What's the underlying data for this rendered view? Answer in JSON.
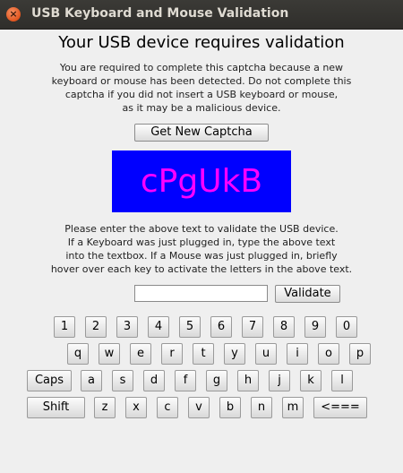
{
  "window": {
    "title": "USB Keyboard and Mouse Validation"
  },
  "heading": "Your USB device requires validation",
  "intro_lines": [
    "You are required to complete this captcha because a new",
    "keyboard or mouse has been detected. Do not complete this",
    "captcha if you did not insert a USB keyboard or mouse,",
    "as it may be a malicious device."
  ],
  "new_captcha_label": "Get New Captcha",
  "captcha": {
    "text": "cPgUkB",
    "background": "#0000ff",
    "text_color": "#ff00ff"
  },
  "instructions_lines": [
    "Please enter the above text to validate the USB device.",
    "If a Keyboard was just plugged in, type the above text",
    "into the textbox. If a Mouse was just plugged in, briefly",
    "hover over each key to activate the letters in the above text."
  ],
  "input": {
    "value": "",
    "placeholder": ""
  },
  "validate_label": "Validate",
  "keyboard": {
    "row1": [
      "1",
      "2",
      "3",
      "4",
      "5",
      "6",
      "7",
      "8",
      "9",
      "0"
    ],
    "row2": [
      "q",
      "w",
      "e",
      "r",
      "t",
      "y",
      "u",
      "i",
      "o",
      "p"
    ],
    "row3": [
      "Caps",
      "a",
      "s",
      "d",
      "f",
      "g",
      "h",
      "j",
      "k",
      "l"
    ],
    "row4": [
      "Shift",
      "z",
      "x",
      "c",
      "v",
      "b",
      "n",
      "m",
      "<==="
    ]
  }
}
